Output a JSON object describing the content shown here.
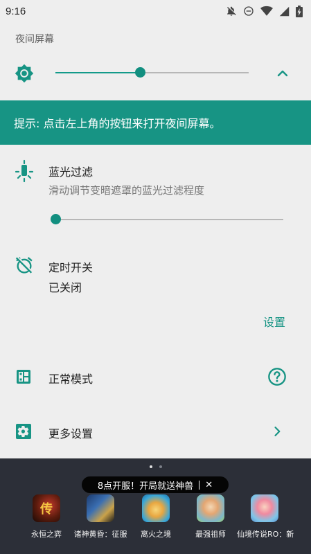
{
  "status_bar": {
    "time": "9:16",
    "icons": [
      "notifications-off-icon",
      "do-not-disturb-icon",
      "wifi-icon",
      "signal-icon",
      "battery-charging-icon"
    ]
  },
  "app": {
    "title": "夜间屏幕"
  },
  "brightness": {
    "level": 0.44
  },
  "hint": {
    "text": "提示: 点击左上角的按钮来打开夜间屏幕。"
  },
  "blue_filter": {
    "title": "蓝光过滤",
    "subtitle": "滑动调节变暗遮罩的蓝光过滤程度",
    "level": 0.0
  },
  "schedule": {
    "title": "定时开关",
    "status": "已关闭",
    "settings_link": "设置"
  },
  "mode": {
    "title": "正常模式"
  },
  "more": {
    "title": "更多设置"
  },
  "ad": {
    "promo_text": "8点开服！开局就送神兽",
    "close_label": "✕",
    "page_count": 2,
    "active_page": 0,
    "apps": [
      {
        "name": "永恒之弈"
      },
      {
        "name": "诸神黄昏：征服"
      },
      {
        "name": "离火之境"
      },
      {
        "name": "最强祖师"
      },
      {
        "name": "仙境传说RO：新"
      }
    ]
  },
  "colors": {
    "accent": "#179484",
    "background": "#eeeeee",
    "ad_background": "#2c2f38"
  }
}
